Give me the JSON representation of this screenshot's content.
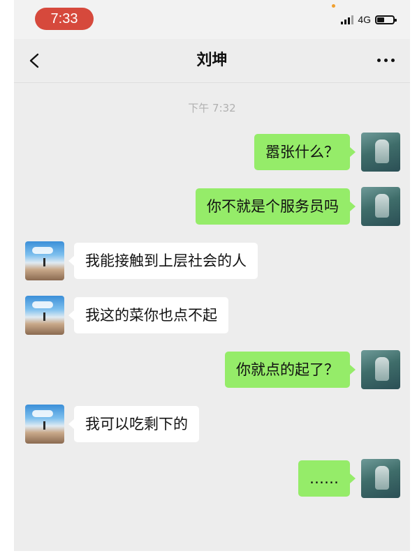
{
  "status_bar": {
    "time": "7:33",
    "network": "4G",
    "icons": [
      "signal-icon",
      "battery-icon"
    ]
  },
  "nav": {
    "title": "刘坤",
    "back_icon": "chevron-left-icon",
    "more_icon": "more-dots-icon"
  },
  "chat": {
    "timestamp": "下午 7:32",
    "messages": [
      {
        "from": "me",
        "text": "嚣张什么？"
      },
      {
        "from": "me",
        "text": "你不就是个服务员吗"
      },
      {
        "from": "other",
        "text": "我能接触到上层社会的人"
      },
      {
        "from": "other",
        "text": "我这的菜你也点不起"
      },
      {
        "from": "me",
        "text": "你就点的起了？"
      },
      {
        "from": "other",
        "text": "我可以吃剩下的"
      },
      {
        "from": "me",
        "text": "……"
      }
    ]
  },
  "colors": {
    "sent_bubble": "#95ec69",
    "received_bubble": "#ffffff",
    "chat_background": "#ededed",
    "time_pill": "#d6493c"
  }
}
